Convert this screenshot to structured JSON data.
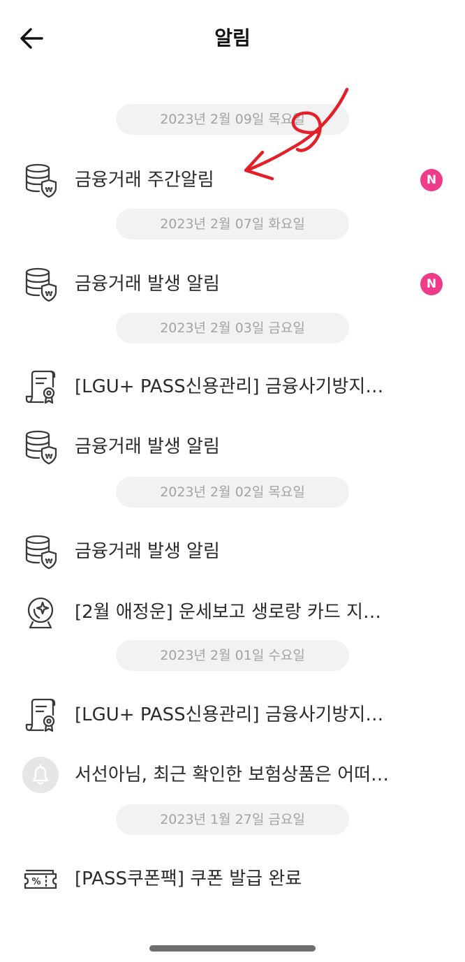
{
  "header": {
    "title": "알림",
    "back_icon": "arrow-left-icon"
  },
  "groups": [
    {
      "date": "2023년 2월 09일 목요일",
      "items": [
        {
          "icon": "coin-shield-icon",
          "text": "금융거래 주간알림",
          "badge": "N"
        }
      ]
    },
    {
      "date": "2023년 2월 07일 화요일",
      "items": [
        {
          "icon": "coin-shield-icon",
          "text": "금융거래 발생 알림",
          "badge": "N"
        }
      ]
    },
    {
      "date": "2023년 2월 03일 금요일",
      "items": [
        {
          "icon": "certificate-icon",
          "text": "[LGU+ PASS신용관리] 금융사기방지…"
        },
        {
          "icon": "coin-shield-icon",
          "text": "금융거래 발생 알림"
        }
      ]
    },
    {
      "date": "2023년 2월 02일 목요일",
      "items": [
        {
          "icon": "coin-shield-icon",
          "text": "금융거래 발생 알림"
        },
        {
          "icon": "crystal-ball-icon",
          "text": "[2월 애정운] 운세보고 생로랑 카드 지…"
        }
      ]
    },
    {
      "date": "2023년 2월 01일 수요일",
      "items": [
        {
          "icon": "certificate-icon",
          "text": "[LGU+ PASS신용관리] 금융사기방지…"
        },
        {
          "icon": "bell-icon",
          "text": "서선아님, 최근 확인한 보험상품은 어떠…"
        }
      ]
    },
    {
      "date": "2023년 1월 27일 금요일",
      "items": [
        {
          "icon": "coupon-icon",
          "text": "[PASS쿠폰팩] 쿠폰 발급 완료"
        }
      ]
    }
  ],
  "colors": {
    "badge": "#ee3b8a",
    "pill_bg": "#f2f2f2",
    "pill_text": "#a3a3a3",
    "annotation": "#e3202a"
  }
}
